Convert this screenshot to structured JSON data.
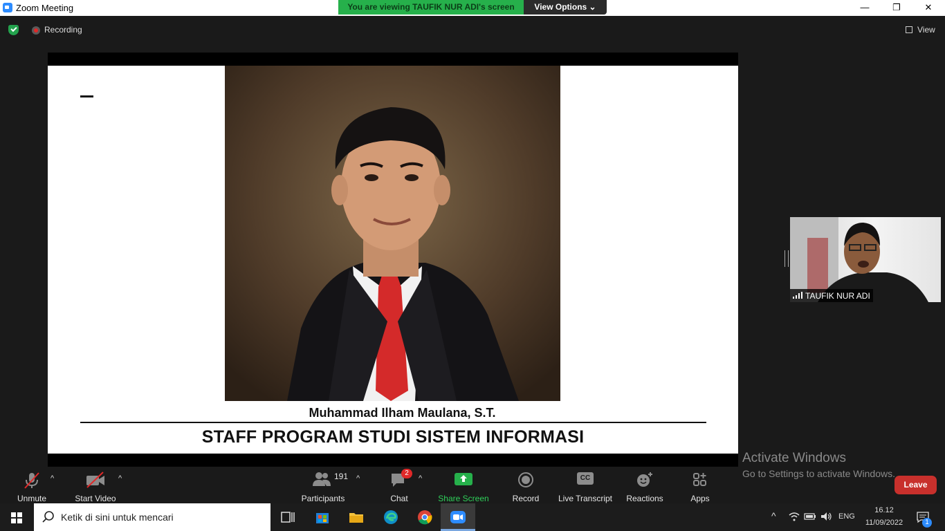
{
  "window": {
    "title": "Zoom Meeting",
    "minimize": "—",
    "maximize": "❐",
    "close": "✕"
  },
  "banner": {
    "viewing_text": "You are viewing TAUFIK NUR ADI's screen",
    "view_options": "View Options ⌄"
  },
  "meeting_bar": {
    "recording_label": "Recording",
    "view_label": "View"
  },
  "slide": {
    "name": "Muhammad Ilham Maulana, S.T.",
    "title": "STAFF PROGRAM STUDI SISTEM INFORMASI"
  },
  "participant_tile": {
    "name": "TAUFIK NUR ADI"
  },
  "activation": {
    "line1": "Activate Windows",
    "line2": "Go to Settings to activate Windows."
  },
  "toolbar": {
    "unmute": "Unmute",
    "start_video": "Start Video",
    "participants": "Participants",
    "participants_count": "191",
    "chat": "Chat",
    "chat_badge": "2",
    "share_screen": "Share Screen",
    "record": "Record",
    "live_transcript": "Live Transcript",
    "cc_glyph": "CC",
    "reactions": "Reactions",
    "apps": "Apps",
    "leave": "Leave",
    "caret": "^"
  },
  "taskbar": {
    "search_placeholder": "Ketik di sini untuk mencari",
    "language": "ENG",
    "time": "16.12",
    "date": "11/09/2022",
    "notification_count": "1"
  },
  "colors": {
    "share_green": "#26b04b",
    "leave_red": "#c8302c",
    "zoom_blue": "#2d8cff",
    "badge_red": "#e02828"
  }
}
